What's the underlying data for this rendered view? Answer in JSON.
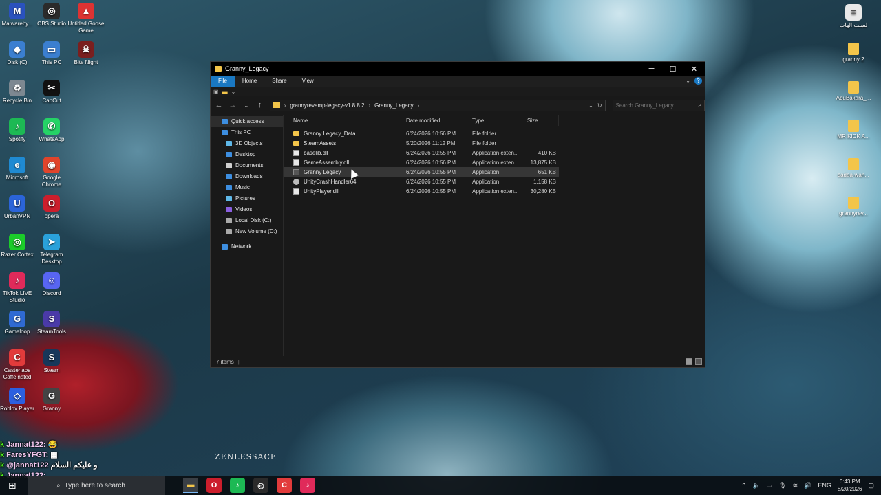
{
  "desktop_left": [
    {
      "label": "Malwareby...",
      "icon": "malwarebytes-icon",
      "color": "#2a52be",
      "glyph": "M"
    },
    {
      "label": "OBS Studio",
      "icon": "obs-icon",
      "color": "#2b2b2b",
      "glyph": "◎"
    },
    {
      "label": "Untitled Goose Game",
      "icon": "goose-icon",
      "color": "#d33",
      "glyph": "▲"
    },
    {
      "label": "Disk (C)",
      "icon": "disk-icon",
      "color": "#3b7fd0",
      "glyph": "◆"
    },
    {
      "label": "This PC",
      "icon": "pc-icon",
      "color": "#3b7fd0",
      "glyph": "▭"
    },
    {
      "label": "Bite Night",
      "icon": "bite-night-icon",
      "color": "#7a1f1f",
      "glyph": "☠"
    },
    {
      "label": "Recycle Bin",
      "icon": "recycle-bin-icon",
      "color": "#7d8891",
      "glyph": "♻"
    },
    {
      "label": "CapCut",
      "icon": "capcut-icon",
      "color": "#111",
      "glyph": "✂"
    },
    {
      "label": "Spotify",
      "icon": "spotify-icon",
      "color": "#1db954",
      "glyph": "♪"
    },
    {
      "label": "WhatsApp",
      "icon": "whatsapp-icon",
      "color": "#25d366",
      "glyph": "✆"
    },
    {
      "label": "Microsoft",
      "icon": "edge-icon",
      "color": "#1f8ad2",
      "glyph": "e"
    },
    {
      "label": "Google Chrome",
      "icon": "chrome-icon",
      "color": "#e0442b",
      "glyph": "◉"
    },
    {
      "label": "UrbanVPN",
      "icon": "urbanvpn-icon",
      "color": "#2b64d9",
      "glyph": "U"
    },
    {
      "label": "opera",
      "icon": "opera-icon",
      "color": "#cc1e2c",
      "glyph": "O"
    },
    {
      "label": "Razer Cortex",
      "icon": "razer-icon",
      "color": "#1bcc2a",
      "glyph": "◎"
    },
    {
      "label": "Telegram Desktop",
      "icon": "telegram-icon",
      "color": "#2aa1da",
      "glyph": "➤"
    },
    {
      "label": "TikTok LIVE Studio",
      "icon": "tiktok-icon",
      "color": "#e02a5a",
      "glyph": "♪"
    },
    {
      "label": "Discord",
      "icon": "discord-icon",
      "color": "#5865f2",
      "glyph": "☺"
    },
    {
      "label": "Gameloop",
      "icon": "gameloop-icon",
      "color": "#2f6ad3",
      "glyph": "G"
    },
    {
      "label": "SteamTools",
      "icon": "steamtools-icon",
      "color": "#4a3aa8",
      "glyph": "S"
    },
    {
      "label": "Casterlabs Caffeinated",
      "icon": "casterlabs-icon",
      "color": "#e23b3b",
      "glyph": "C"
    },
    {
      "label": "Steam",
      "icon": "steam-icon",
      "color": "#17375a",
      "glyph": "S"
    },
    {
      "label": "Roblox Player",
      "icon": "roblox-icon",
      "color": "#2c5fe0",
      "glyph": "◇"
    },
    {
      "label": "Granny",
      "icon": "granny-icon",
      "color": "#444",
      "glyph": "G"
    }
  ],
  "desktop_right": [
    {
      "label": "لسنت الهات",
      "icon": "document-icon",
      "color": "#e8e8e8",
      "glyph": "≡"
    },
    {
      "label": "granny 2",
      "icon": "folder-icon",
      "color": "#f3c54a",
      "glyph": ""
    },
    {
      "label": "AbuBakara_...",
      "icon": "folder-icon",
      "color": "#f3c54a",
      "glyph": ""
    },
    {
      "label": "MR KICK A...",
      "icon": "folder-icon",
      "color": "#f3c54a",
      "glyph": ""
    },
    {
      "label": "sadea-wan...",
      "icon": "folder-icon",
      "color": "#f3c54a",
      "glyph": ""
    },
    {
      "label": "grannyrev...",
      "icon": "folder-icon",
      "color": "#f3c54a",
      "glyph": ""
    }
  ],
  "window": {
    "title": "Granny_Legacy",
    "ribbon_tabs": [
      "File",
      "Home",
      "Share",
      "View"
    ],
    "address": {
      "segments": [
        "grannyrevamp-legacy-v1.8.8.2",
        "Granny_Legacy"
      ]
    },
    "search_placeholder": "Search Granny_Legacy",
    "nav": [
      {
        "label": "Quick access",
        "icon": "star-icon",
        "color": "#3d8ee0",
        "level": 0,
        "selected": true
      },
      {
        "label": "This PC",
        "icon": "pc-icon",
        "color": "#3d8ee0",
        "level": 0
      },
      {
        "label": "3D Objects",
        "icon": "cube-icon",
        "color": "#5fb8e8",
        "level": 1
      },
      {
        "label": "Desktop",
        "icon": "desktop-icon",
        "color": "#3d8ee0",
        "level": 1
      },
      {
        "label": "Documents",
        "icon": "documents-icon",
        "color": "#cfcfcf",
        "level": 1
      },
      {
        "label": "Downloads",
        "icon": "download-icon",
        "color": "#3d8ee0",
        "level": 1
      },
      {
        "label": "Music",
        "icon": "music-icon",
        "color": "#3d8ee0",
        "level": 1
      },
      {
        "label": "Pictures",
        "icon": "pictures-icon",
        "color": "#5fb8e8",
        "level": 1
      },
      {
        "label": "Videos",
        "icon": "videos-icon",
        "color": "#8a5fe0",
        "level": 1
      },
      {
        "label": "Local Disk (C:)",
        "icon": "drive-icon",
        "color": "#aaa",
        "level": 1
      },
      {
        "label": "New Volume (D:)",
        "icon": "drive-icon",
        "color": "#aaa",
        "level": 1
      },
      {
        "label": "Network",
        "icon": "network-icon",
        "color": "#3d8ee0",
        "level": 0
      }
    ],
    "columns": [
      "Name",
      "Date modified",
      "Type",
      "Size"
    ],
    "files": [
      {
        "name": "Granny Legacy_Data",
        "date": "6/24/2026 10:56 PM",
        "type": "File folder",
        "size": "",
        "kind": "folder"
      },
      {
        "name": "SteamAssets",
        "date": "5/20/2026 11:12 PM",
        "type": "File folder",
        "size": "",
        "kind": "folder"
      },
      {
        "name": "baselib.dll",
        "date": "6/24/2026 10:55 PM",
        "type": "Application exten...",
        "size": "410 KB",
        "kind": "dll"
      },
      {
        "name": "GameAssembly.dll",
        "date": "6/24/2026 10:56 PM",
        "type": "Application exten...",
        "size": "13,875 KB",
        "kind": "dll"
      },
      {
        "name": "Granny Legacy",
        "date": "6/24/2026 10:55 PM",
        "type": "Application",
        "size": "651 KB",
        "kind": "app",
        "hover": true
      },
      {
        "name": "UnityCrashHandler64",
        "date": "6/24/2026 10:55 PM",
        "type": "Application",
        "size": "1,158 KB",
        "kind": "gear"
      },
      {
        "name": "UnityPlayer.dll",
        "date": "6/24/2026 10:55 PM",
        "type": "Application exten...",
        "size": "30,280 KB",
        "kind": "dll"
      }
    ],
    "status": "7 items"
  },
  "watermark": "ZENLESSACE",
  "chat": [
    {
      "name": "Jannat122:",
      "text": "😂"
    },
    {
      "name": "FaresYFGT:",
      "text": "▦"
    },
    {
      "name": "@jannat122",
      "text": "و عليكم السلام"
    },
    {
      "name": "Jannat122:",
      "text": ""
    }
  ],
  "taskbar": {
    "search_placeholder": "Type here to search",
    "apps": [
      {
        "icon": "file-explorer-icon",
        "color": "#f3c54a",
        "glyph": "▬",
        "active": true
      },
      {
        "icon": "opera-icon",
        "color": "#cc1e2c",
        "glyph": "O"
      },
      {
        "icon": "spotify-icon",
        "color": "#1db954",
        "glyph": "♪"
      },
      {
        "icon": "obs-icon",
        "color": "#2b2b2b",
        "glyph": "◎"
      },
      {
        "icon": "casterlabs-icon",
        "color": "#e23b3b",
        "glyph": "C"
      },
      {
        "icon": "tiktok-icon",
        "color": "#e02a5a",
        "glyph": "♪"
      }
    ],
    "language": "ENG",
    "time": "6:43 PM",
    "date": "8/20/2026"
  }
}
